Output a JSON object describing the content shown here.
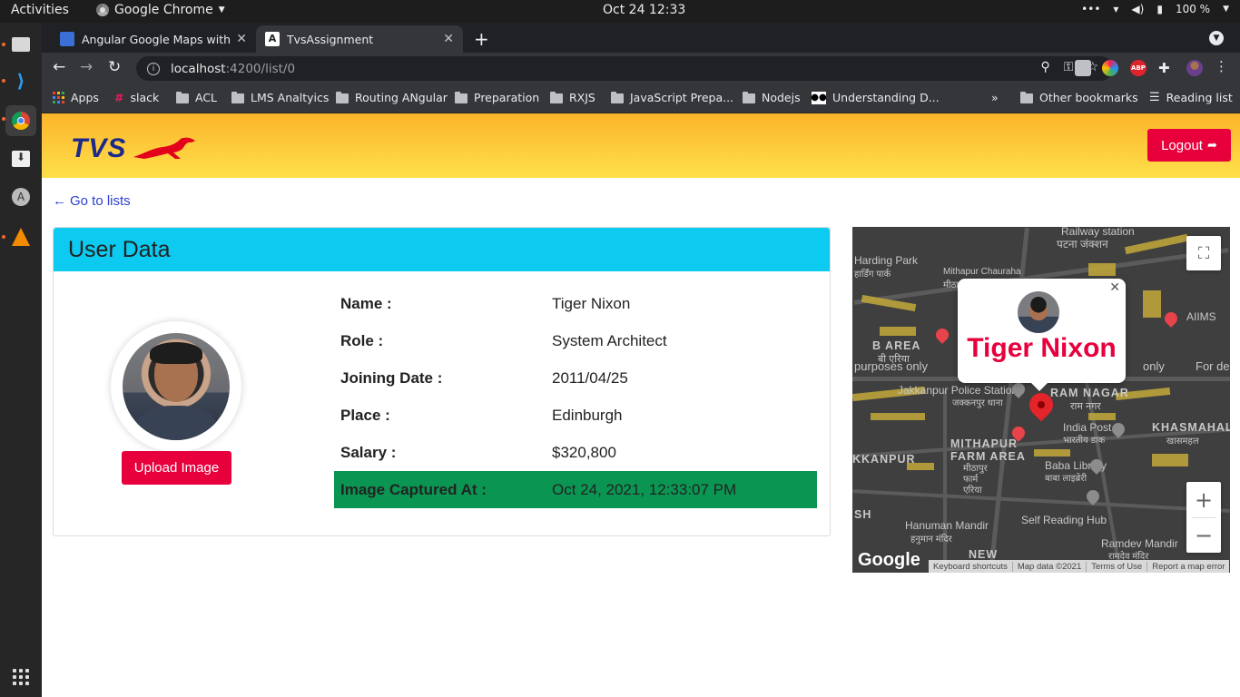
{
  "system": {
    "activities": "Activities",
    "app_menu": "Google Chrome",
    "clock": "Oct 24  12:33",
    "battery": "100 %"
  },
  "browser": {
    "tabs": [
      {
        "title": "Angular Google Maps with Pl",
        "active": false
      },
      {
        "title": "TvsAssignment",
        "active": true
      }
    ],
    "url_host": "localhost",
    "url_path": ":4200/list/0",
    "bookmarks": [
      "Apps",
      "slack",
      "ACL",
      "LMS Analtyics",
      "Routing ANgular",
      "Preparation",
      "RXJS",
      "JavaScript Prepa...",
      "Nodejs",
      "Understanding D...",
      "Other bookmarks",
      "Reading list"
    ]
  },
  "app": {
    "brand": "TVS",
    "logout_label": "Logout",
    "back_link": "Go to lists",
    "card_title": "User Data",
    "upload_label": "Upload Image",
    "details": [
      {
        "label": "Name :",
        "value": "Tiger Nixon"
      },
      {
        "label": "Role :",
        "value": "System Architect"
      },
      {
        "label": "Joining Date :",
        "value": "2011/04/25"
      },
      {
        "label": "Place :",
        "value": "Edinburgh"
      },
      {
        "label": "Salary :",
        "value": "$320,800"
      },
      {
        "label": "Image Captured At :",
        "value": "Oct 24, 2021, 12:33:07 PM"
      }
    ],
    "highlight_color": "#0a9652",
    "accent": "#e8003d",
    "header_color": "#0dcaf0"
  },
  "map": {
    "infowindow_name": "Tiger Nixon",
    "labels": [
      "Railway station",
      "पटना जंक्शन",
      "Harding Park",
      "हार्डिंग पार्क",
      "Mithapur Chauraha",
      "मीठापुर चौराहा",
      "B AREA",
      "बी एरिया",
      "purposes only",
      "only",
      "For de",
      "Jakkanpur Police Station",
      "जक्कनपुर थाना",
      "RAM NAGAR",
      "राम नगर",
      "India Post",
      "भारतीय डाक",
      "KHASMAHAL",
      "खासमहल",
      "MITHAPUR",
      "FARM AREA",
      "मीठापुर",
      "फार्म",
      "एरिया",
      "KKANPUR",
      "Baba Library",
      "बाबा लाइब्रेरी",
      "Self Reading Hub",
      "Hanuman Mandir",
      "हनुमान मंदिर",
      "Ramdev Mandir",
      "रामदेव मंदिर",
      "AIIMS",
      "SH",
      "NEW"
    ],
    "logo": "Google",
    "attribution": [
      "Keyboard shortcuts",
      "Map data ©2021",
      "Terms of Use",
      "Report a map error"
    ]
  }
}
